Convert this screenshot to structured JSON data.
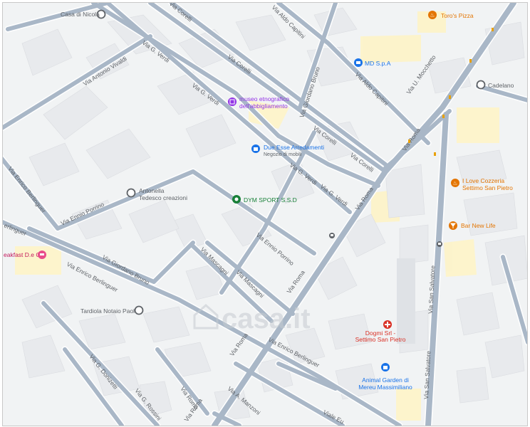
{
  "map": {
    "colors": {
      "background": "#f1f3f4",
      "block": "#e8eaed",
      "road": "#a9b7c7",
      "road_edge": "#ffffff",
      "poi_label": "#1a73e8",
      "poi_gray": "#5f6368",
      "poi_green": "#188038",
      "poi_orange": "#e37400",
      "poi_red": "#d93025",
      "poi_purple": "#9334e6",
      "poi_pink": "#c2185b",
      "highlight": "#fff3c4"
    },
    "watermark": "casa.it",
    "streets": [
      {
        "id": "via-g-verdi-1",
        "text": "Via G. Verdi"
      },
      {
        "id": "via-g-verdi-2",
        "text": "Via G. Verdi"
      },
      {
        "id": "via-g-verdi-3",
        "text": "Via G. Verdi"
      },
      {
        "id": "via-g-verdi-4",
        "text": "Via G. Verdi"
      },
      {
        "id": "via-corelli-1",
        "text": "Via Corelli"
      },
      {
        "id": "via-corelli-2",
        "text": "Via Corelli"
      },
      {
        "id": "via-corelli-3",
        "text": "Via Corelli"
      },
      {
        "id": "via-corelli-4",
        "text": "Via Corelli"
      },
      {
        "id": "via-aldo-capitini-1",
        "text": "Via Aldo Capitini"
      },
      {
        "id": "via-aldo-capitini-2",
        "text": "Via Aldo Capitini"
      },
      {
        "id": "via-antonio-vivaldi",
        "text": "Via Antonio Vivaldi"
      },
      {
        "id": "via-giordano-bruno-1",
        "text": "Via Giordano Bruno"
      },
      {
        "id": "via-giordano-bruno-2",
        "text": "Via Giordano Bruno"
      },
      {
        "id": "via-u-mocchetto",
        "text": "Via U. Mocchetto"
      },
      {
        "id": "via-roma-1",
        "text": "Via Roma"
      },
      {
        "id": "via-roma-2",
        "text": "Via Roma"
      },
      {
        "id": "via-roma-3",
        "text": "Via Roma"
      },
      {
        "id": "via-roma-4",
        "text": "Via Roma"
      },
      {
        "id": "via-roma-5",
        "text": "Via Roma"
      },
      {
        "id": "via-roma-6",
        "text": "Via Roma"
      },
      {
        "id": "via-enrico-berlinguer-1",
        "text": "Via Enrico Berlinguer"
      },
      {
        "id": "via-enrico-berlinguer-2",
        "text": "Via Enrico Berlinguer"
      },
      {
        "id": "via-enrico-berlinguer-3",
        "text": "Via Enrico Berlinguer"
      },
      {
        "id": "via-enrico-berlinguer-4",
        "text": "erlinguer"
      },
      {
        "id": "via-ennio-porrino-1",
        "text": "Via Ennio Porrino"
      },
      {
        "id": "via-ennio-porrino-2",
        "text": "Via Ennio Porrino"
      },
      {
        "id": "via-mascagni-1",
        "text": "Via Mascagni"
      },
      {
        "id": "via-mascagni-2",
        "text": "Via Mascagni"
      },
      {
        "id": "via-san-salvatore-1",
        "text": "Via San Salvatore"
      },
      {
        "id": "via-san-salvatore-2",
        "text": "Via San Salvatore"
      },
      {
        "id": "via-g-donizetti",
        "text": "Via G. Donizetti"
      },
      {
        "id": "via-g-rossini",
        "text": "Via G. Rossini"
      },
      {
        "id": "via-a-manzoni",
        "text": "Via A. Manzoni"
      },
      {
        "id": "viale-europa",
        "text": "Viale Eu"
      }
    ],
    "pois": [
      {
        "id": "casa-di-nicola",
        "name": "Casa di Nicola",
        "icon": "pin-icon",
        "color": "#5f6368"
      },
      {
        "id": "toros-pizza",
        "name": "Toro's Pizza",
        "icon": "fork-knife-icon",
        "color": "#e37400"
      },
      {
        "id": "md-spa",
        "name": "MD S.p.A",
        "icon": "cart-icon",
        "color": "#1a73e8"
      },
      {
        "id": "cadelano",
        "name": "Cadelano",
        "icon": "pin-icon",
        "color": "#5f6368"
      },
      {
        "id": "museo",
        "name": "museo etnografico",
        "name2": "dell'abbigliamento",
        "icon": "museum-icon",
        "color": "#9334e6"
      },
      {
        "id": "due-esse",
        "name": "Due Esse Arredamenti",
        "name2": "Negozio di mobili",
        "icon": "shopping-bag-icon",
        "color": "#1a73e8"
      },
      {
        "id": "antonella",
        "name": "Antonella",
        "name2": "Tedesco creazioni",
        "icon": "pin-icon",
        "color": "#5f6368"
      },
      {
        "id": "dym-sport",
        "name": "DYM SPORT S.S.D",
        "icon": "sport-icon",
        "color": "#188038"
      },
      {
        "id": "i-love-cozzeria",
        "name": "I Love Cozzeria",
        "name2": "Settimo San Pietro",
        "icon": "fork-knife-icon",
        "color": "#e37400"
      },
      {
        "id": "bar-new-life",
        "name": "Bar New Life",
        "icon": "cocktail-icon",
        "color": "#e37400"
      },
      {
        "id": "breakfast",
        "name": "eakfast D.e G",
        "icon": "bed-icon",
        "color": "#c2185b"
      },
      {
        "id": "tardiola",
        "name": "Tardiola Notaio Paolo",
        "icon": "pin-icon",
        "color": "#5f6368"
      },
      {
        "id": "dogmi",
        "name": "Dogmi Srl -",
        "name2": "Settimo San Pietro",
        "icon": "medical-icon",
        "color": "#d93025"
      },
      {
        "id": "animal-garden",
        "name": "Animal Garden di",
        "name2": "Mereu Massimiliano",
        "icon": "shopping-bag-icon",
        "color": "#1a73e8"
      }
    ]
  }
}
